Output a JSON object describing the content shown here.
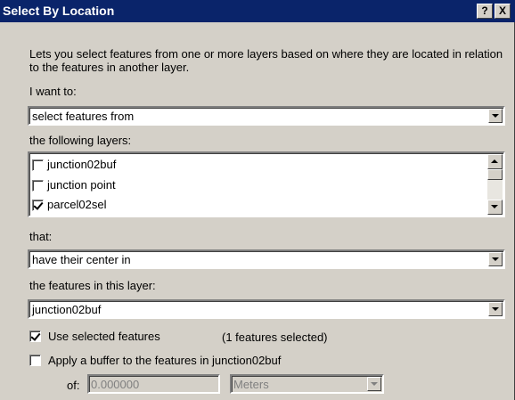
{
  "window": {
    "title": "Select By Location",
    "help_label": "?",
    "close_label": "X"
  },
  "description": "Lets you select features from one or more layers based on where they are located in relation to the features in another layer.",
  "i_want_to": {
    "label": "I want to:",
    "value": "select features from"
  },
  "layers": {
    "label": "the following layers:",
    "items": [
      {
        "label": "junction02buf",
        "checked": false
      },
      {
        "label": "junction point",
        "checked": false
      },
      {
        "label": "parcel02sel",
        "checked": true
      }
    ]
  },
  "that": {
    "label": "that:",
    "value": "have their center in"
  },
  "source_layer": {
    "label": "the features in this layer:",
    "value": "junction02buf"
  },
  "use_selected": {
    "label": "Use selected features",
    "checked": true,
    "count_text": "(1 features selected)"
  },
  "buffer": {
    "label": "Apply a buffer to the features in  junction02buf",
    "checked": false,
    "of_label": "of:",
    "distance": "0.000000",
    "units": "Meters"
  }
}
